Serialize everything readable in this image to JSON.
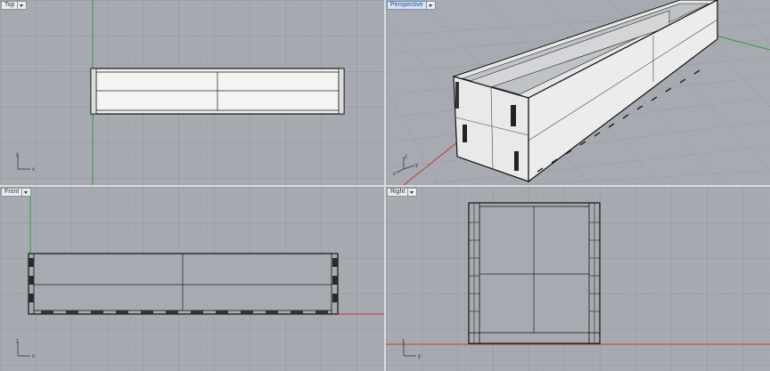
{
  "viewports": {
    "top": {
      "label": "Top",
      "active": false
    },
    "perspective": {
      "label": "Perspective",
      "active": true
    },
    "front": {
      "label": "Front",
      "active": false
    },
    "right": {
      "label": "Right",
      "active": false
    }
  },
  "axes": {
    "x": "x",
    "y": "y",
    "z": "z"
  },
  "colors": {
    "viewport_bg": "#a7abb1",
    "grid": "#9b9fa6",
    "grid_major": "#8c9097",
    "x_axis": "#c23a3a",
    "y_axis": "#2f9d3a",
    "object_face": "#f2f2f2",
    "object_edge": "#111111"
  }
}
